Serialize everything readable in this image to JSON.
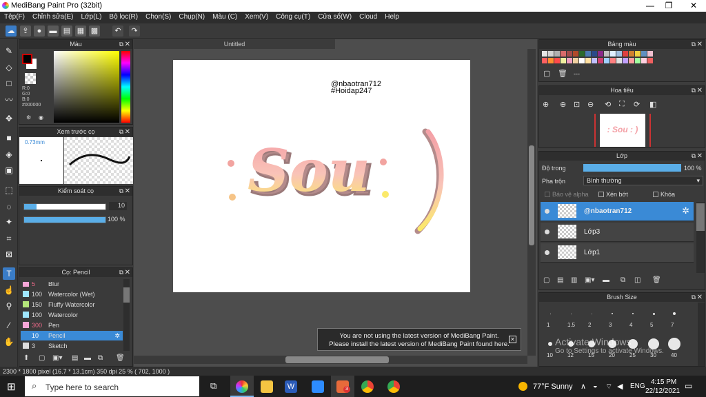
{
  "window": {
    "title": "MediBang Paint Pro (32bit)",
    "min": "—",
    "max": "❐",
    "close": "✕"
  },
  "menu": [
    "Tệp(F)",
    "Chỉnh sửa(E)",
    "Lớp(L)",
    "Bộ lọc(R)",
    "Chọn(S)",
    "Chụp(N)",
    "Màu (C)",
    "Xem(V)",
    "Công cụ(T)",
    "Cửa sổ(W)",
    "Cloud",
    "Help"
  ],
  "toolbar": {
    "undo": "↶",
    "redo": "↷"
  },
  "panels": {
    "color": {
      "title": "Màu",
      "rgb": "R:0\nG:0\nB:0\n#000000",
      "fg": "#000000",
      "bg": "#ffffff"
    },
    "brush_preview": {
      "title": "Xem trước cọ",
      "size": "0.73mm"
    },
    "brush_control": {
      "title": "Kiểm soát cọ",
      "size": "10",
      "opacity": "100 %",
      "size_fraction": 0.15,
      "opacity_fraction": 1.0
    },
    "brush": {
      "title": "Cọ: Pencil",
      "items": [
        {
          "size": "5",
          "name": "Blur",
          "color": "#f6a6d8",
          "sizecolor": "#f06a8a"
        },
        {
          "size": "100",
          "name": "Watercolor (Wet)",
          "color": "#9fe6ff",
          "sizecolor": "#dddddd"
        },
        {
          "size": "150",
          "name": "Fluffy Watercolor",
          "color": "#b4e67a",
          "sizecolor": "#dddddd"
        },
        {
          "size": "100",
          "name": "Watercolor",
          "color": "#9fe6ff",
          "sizecolor": "#dddddd"
        },
        {
          "size": "300",
          "name": "Pen",
          "color": "#f6a6d8",
          "sizecolor": "#f06a8a"
        },
        {
          "size": "10",
          "name": "Pencil",
          "color": "#3a8ad6",
          "sizecolor": "#ffffff"
        },
        {
          "size": "3",
          "name": "Sketch",
          "color": "#dddddd",
          "sizecolor": "#dddddd"
        }
      ]
    },
    "palette": {
      "title": "Bảng màu",
      "footer": "---"
    },
    "navigator": {
      "title": "Hoa tiêu"
    },
    "layers": {
      "title": "Lớp",
      "opacity_label": "Độ trong",
      "opacity": "100 %",
      "opacity_fraction": 1.0,
      "blend_label": "Pha trộn",
      "blend": "Bình thường",
      "alpha": "Bảo vệ alpha",
      "clip": "Xén bớt",
      "lock": "Khóa",
      "items": [
        {
          "name": "@nbaotran712",
          "active": true
        },
        {
          "name": "Lớp3",
          "active": false
        },
        {
          "name": "Lớp1",
          "active": false
        }
      ]
    },
    "brushsize": {
      "title": "Brush Size",
      "row1": [
        "1",
        "1.5",
        "2",
        "3",
        "4",
        "5",
        "7"
      ],
      "row2": [
        "10",
        "12",
        "15",
        "20",
        "25",
        "30",
        "40"
      ]
    }
  },
  "document": {
    "tab": "Untitled",
    "credit1": "@nbaotran712",
    "credit2": "#Hoidap247",
    "art": ": Sou : )"
  },
  "notice": {
    "line1": "You are not using the latest version of MediBang Paint.",
    "line2": "Please install the latest version of MediBang Paint found here."
  },
  "watermark": {
    "line1": "Activate Windows",
    "line2": "Go to Settings to activate Windows."
  },
  "status": "2300 * 1800 pixel   (16.7 * 13.1cm)   350 dpi   25 %   ( 702, 1000 )",
  "taskbar": {
    "search": "Type here to search",
    "weather": "77°F  Sunny",
    "lang": "ENG",
    "time": "4:15 PM",
    "date": "22/12/2021",
    "badge": "3"
  }
}
